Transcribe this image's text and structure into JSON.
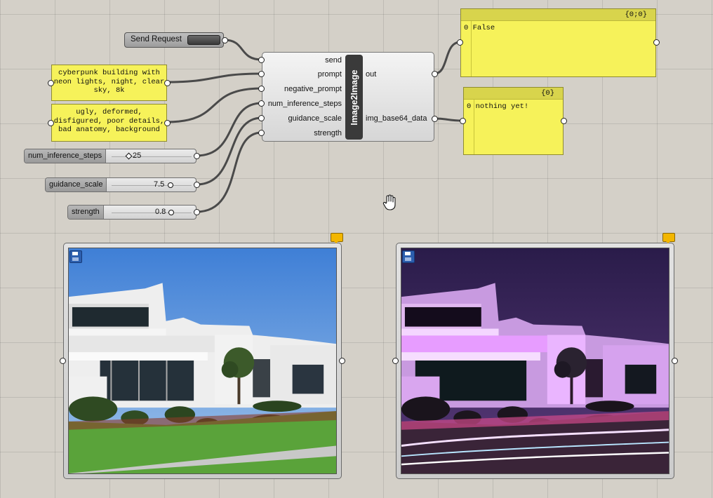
{
  "send_request": {
    "label": "Send Request"
  },
  "prompt_panel": {
    "text": "cyberpunk building with neon lights, night, clear sky, 8k"
  },
  "negative_panel": {
    "text": "ugly, deformed, disfigured, poor details, bad anatomy, background"
  },
  "sliders": {
    "num_inference_steps": {
      "label": "num_inference_steps",
      "value": "25"
    },
    "guidance_scale": {
      "label": "guidance_scale",
      "value": "7.5"
    },
    "strength": {
      "label": "strength",
      "value": "0.8"
    }
  },
  "component": {
    "title": "Image2Image",
    "inputs": [
      "send",
      "prompt",
      "negative_prompt",
      "num_inference_steps",
      "guidance_scale",
      "strength"
    ],
    "outputs": [
      "out",
      "img_base64_data"
    ]
  },
  "out_panel": {
    "header": "{0;0}",
    "index": "0",
    "value": "False"
  },
  "img_panel": {
    "header": "{0}",
    "index": "0",
    "value": "nothing yet!"
  },
  "viewers": {
    "input_image": {
      "icon": "save-icon"
    },
    "output_image": {
      "icon": "save-icon"
    }
  },
  "colors": {
    "panel_yellow": "#f6f25a",
    "canvas": "#d4d0c8",
    "wire": "#4a4a4a",
    "neon": "#e79cff"
  }
}
